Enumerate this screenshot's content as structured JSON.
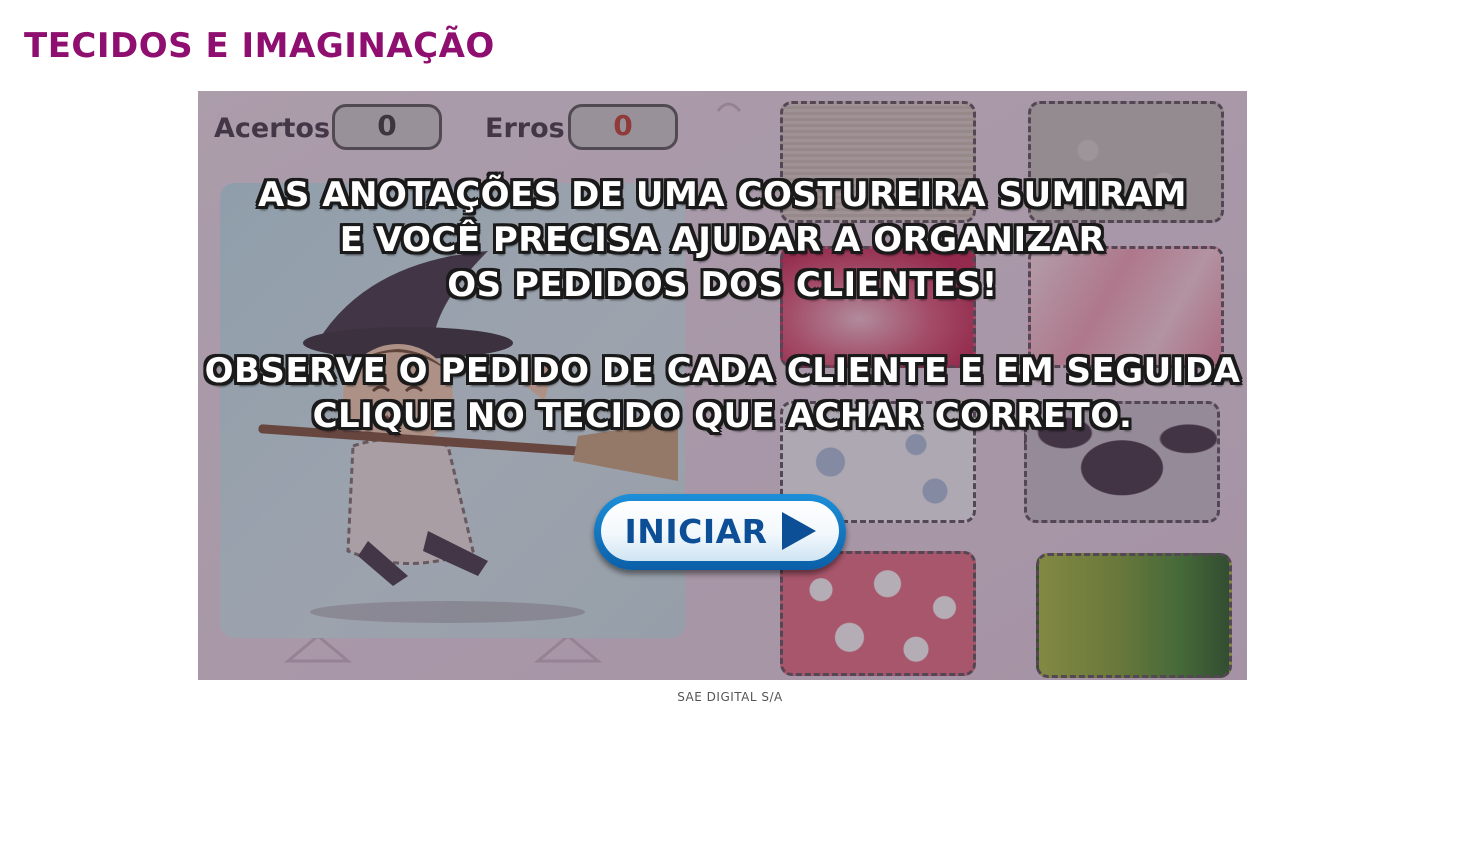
{
  "page": {
    "title": "TECIDOS E IMAGINAÇÃO",
    "footer": "SAE DIGITAL S/A"
  },
  "game": {
    "score": {
      "hits_label": "Acertos",
      "hits_value": "0",
      "errors_label": "Erros",
      "errors_value": "0"
    },
    "instructions": {
      "line1": "AS ANOTAÇÕES DE UMA COSTUREIRA SUMIRAM",
      "line2": "E VOCÊ PRECISA AJUDAR A ORGANIZAR",
      "line3": "OS PEDIDOS DOS CLIENTES!",
      "line4": "OBSERVE O PEDIDO DE CADA CLIENTE E EM SEGUIDA",
      "line5": "CLIQUE NO TECIDO QUE ACHAR CORRETO."
    },
    "start_button_label": "INICIAR",
    "colors": {
      "title": "#8e0f6f",
      "errors_value": "#c0392b",
      "button_text": "#0d4f96"
    },
    "swatches": [
      "linen-fabric",
      "floral-gray-fabric",
      "red-satin-fabric",
      "pink-tulle-fabric",
      "teddy-bear-print-fabric",
      "bat-print-fabric",
      "heart-print-fabric",
      "green-velvet-fabric"
    ]
  }
}
